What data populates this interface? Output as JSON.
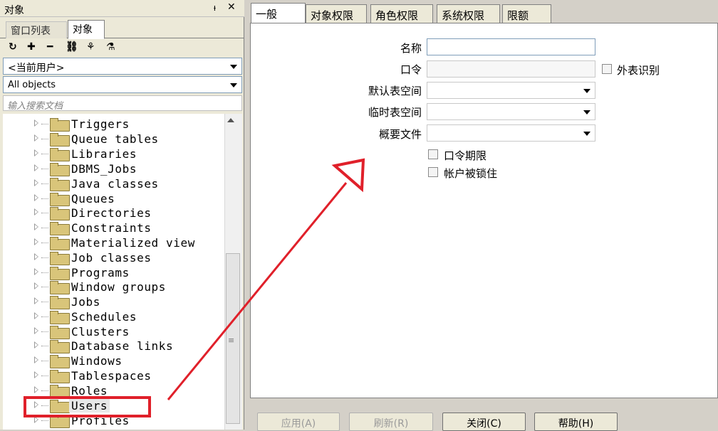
{
  "left_panel": {
    "title": "对象",
    "pin_glyph": "ᵼ",
    "close_glyph": "✕",
    "tabs": [
      {
        "label": "窗口列表"
      },
      {
        "label": "对象"
      }
    ],
    "toolbar": [
      "refresh-icon",
      "add-icon",
      "remove-icon",
      "find-icon",
      "filter-icon",
      "filter-edit-icon"
    ],
    "toolbar_glyphs": [
      "↻",
      "✚",
      "━",
      "⛓",
      "⚘",
      "⚗"
    ],
    "user_combo": "<当前用户>",
    "objects_combo": "All objects",
    "search_placeholder": "输入搜索文档",
    "tree": [
      {
        "label": "Triggers"
      },
      {
        "label": "Queue tables"
      },
      {
        "label": "Libraries"
      },
      {
        "label": "DBMS_Jobs"
      },
      {
        "label": "Java classes"
      },
      {
        "label": "Queues"
      },
      {
        "label": "Directories"
      },
      {
        "label": "Constraints"
      },
      {
        "label": "Materialized view"
      },
      {
        "label": "Job classes"
      },
      {
        "label": "Programs"
      },
      {
        "label": "Window groups"
      },
      {
        "label": "Jobs"
      },
      {
        "label": "Schedules"
      },
      {
        "label": "Clusters"
      },
      {
        "label": "Database links"
      },
      {
        "label": "Windows"
      },
      {
        "label": "Tablespaces"
      },
      {
        "label": "Roles"
      },
      {
        "label": "Users"
      },
      {
        "label": "Profiles"
      }
    ],
    "scroll_grip": "≡"
  },
  "dialog": {
    "tabs": [
      {
        "label": "一般"
      },
      {
        "label": "对象权限"
      },
      {
        "label": "角色权限"
      },
      {
        "label": "系统权限"
      },
      {
        "label": "限额"
      }
    ],
    "fields": {
      "name_label": "名称",
      "name_value": "",
      "password_label": "口令",
      "password_value": "",
      "external_label": "外表识别",
      "default_ts_label": "默认表空间",
      "temp_ts_label": "临时表空间",
      "profile_label": "概要文件",
      "expire_label": "口令期限",
      "locked_label": "帐户被锁住"
    },
    "buttons": {
      "apply": "应用(A)",
      "refresh": "刷新(R)",
      "close": "关闭(C)",
      "help": "帮助(H)"
    }
  },
  "annotation_colors": {
    "highlight": "#e0202a"
  }
}
